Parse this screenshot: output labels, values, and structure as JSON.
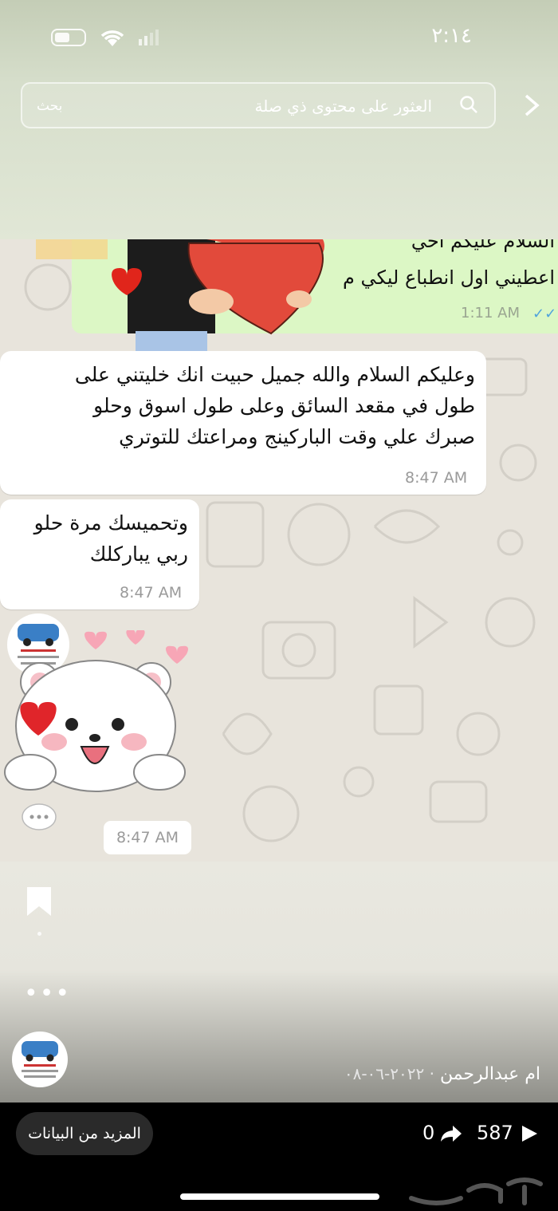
{
  "status": {
    "time": "٢:١٤"
  },
  "search": {
    "placeholder": "العثور على محتوى ذي صلة",
    "button": "بحث"
  },
  "chat": {
    "outgoing": {
      "line1": "السلام عليكم اخي",
      "line2": "اعطيني اول انطباع ليكي م",
      "time": "1:11 AM"
    },
    "incoming": [
      {
        "lines": [
          "وعليكم السلام والله جميل حبيت انك خليتني على",
          "طول في مقعد السائق وعلى طول اسوق وحلو",
          "صبرك علي وقت الباركينج ومراعتك للتوتري"
        ],
        "time": "8:47 AM"
      },
      {
        "lines": [
          "وتحميسك مرة حلو",
          "ربي يباركلك"
        ],
        "time": "8:47 AM"
      }
    ],
    "sticker_time": "8:47 AM"
  },
  "post": {
    "author": "ام عبدالرحمن",
    "date": "٢٠٢٢-٠٦-٠٨"
  },
  "bottom": {
    "more_data": "المزيد من البيانات",
    "views": "587",
    "shares": "0"
  },
  "colors": {
    "outgoing_bubble": "#dcf7c5",
    "incoming_bubble": "#ffffff",
    "chat_bg": "#e8e4dc",
    "read_ticks": "#4fa3dc"
  }
}
